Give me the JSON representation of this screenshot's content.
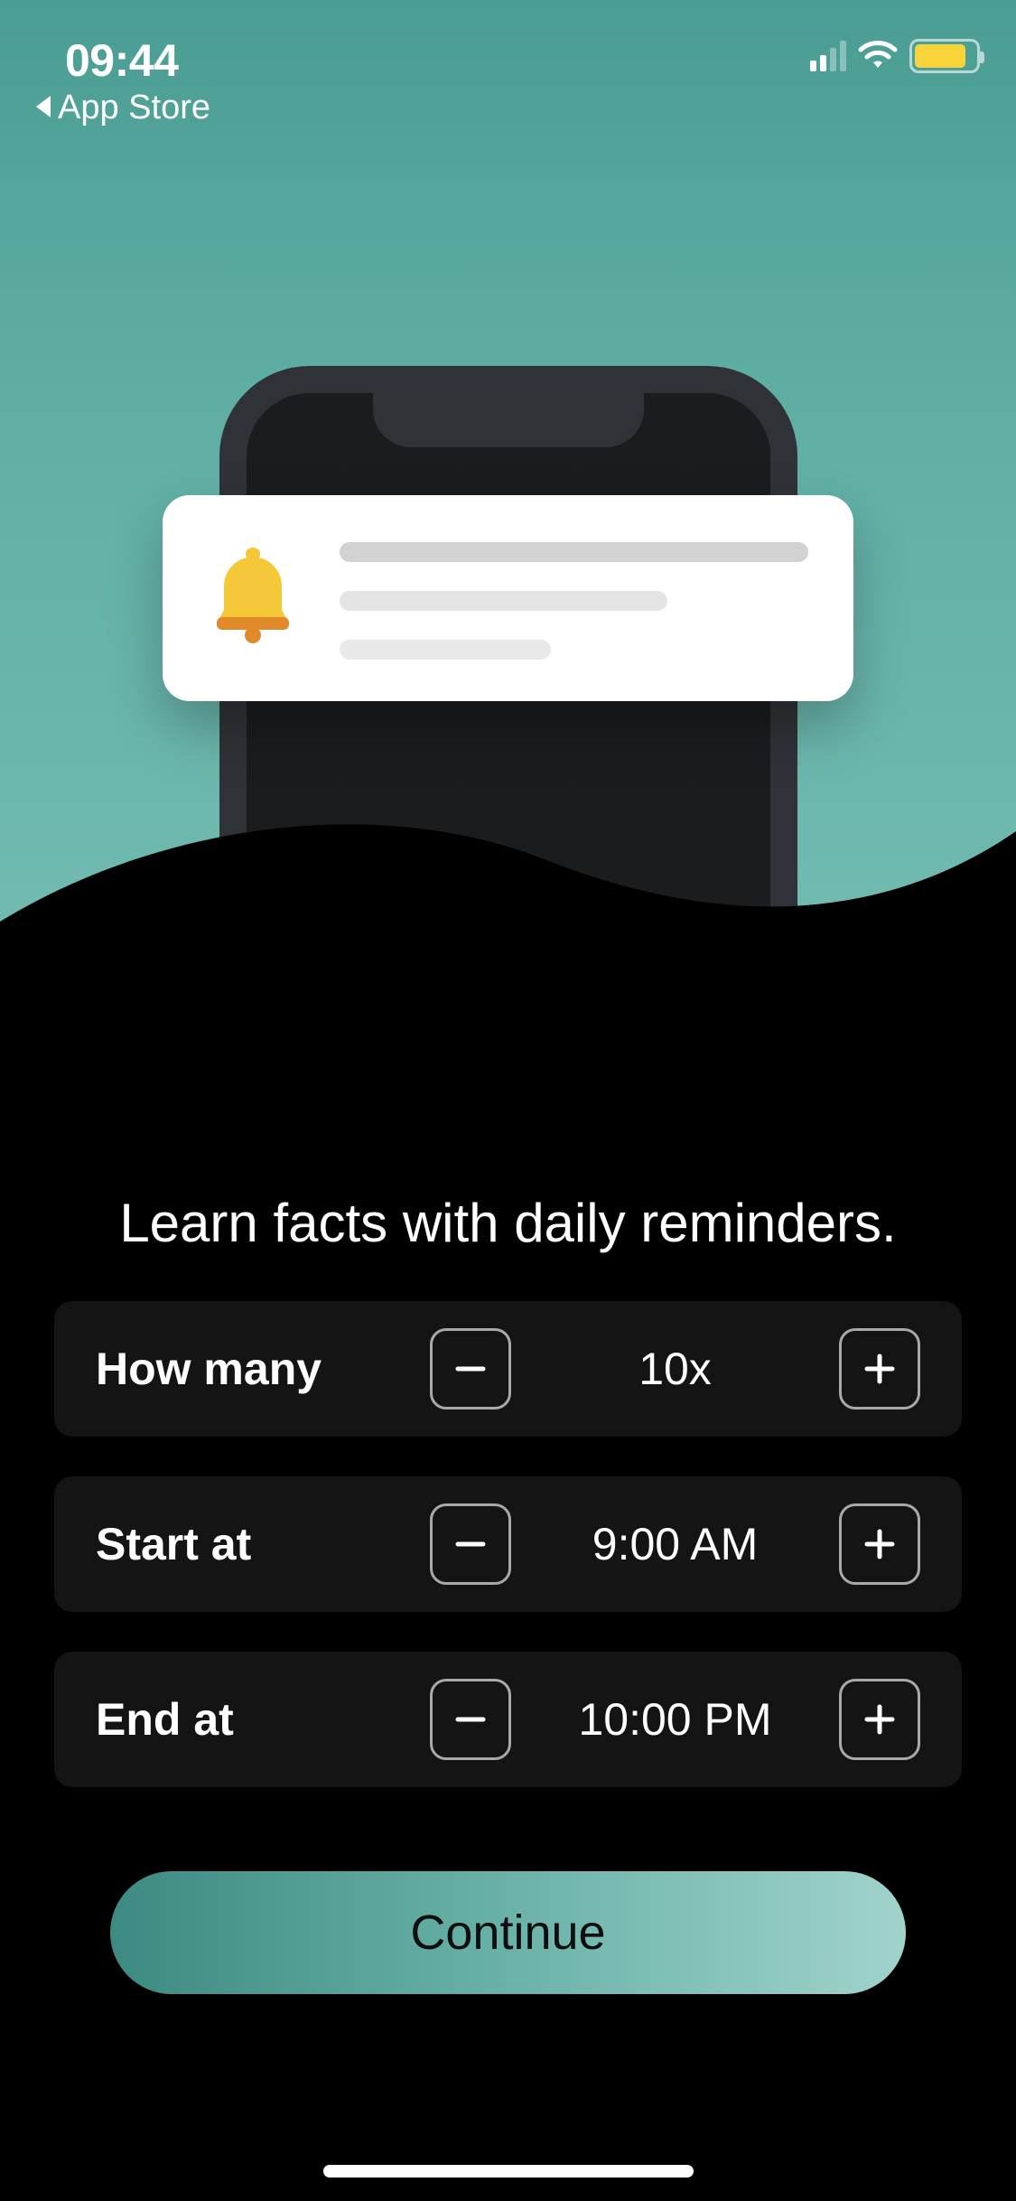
{
  "status_bar": {
    "time": "09:44",
    "back_label": "App Store",
    "battery_color": "#f8d33a"
  },
  "illustration": {
    "icon": "bell-icon"
  },
  "heading": "Learn facts with daily reminders.",
  "rows": {
    "how_many": {
      "label": "How many",
      "value": "10x"
    },
    "start_at": {
      "label": "Start at",
      "value": "9:00 AM"
    },
    "end_at": {
      "label": "End at",
      "value": "10:00 PM"
    }
  },
  "cta_label": "Continue"
}
